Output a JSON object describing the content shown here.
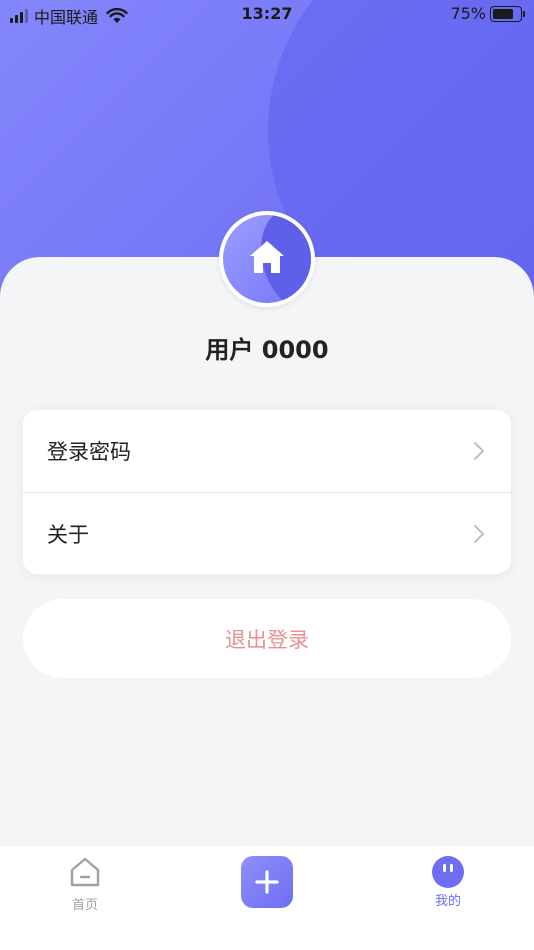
{
  "status_bar": {
    "carrier": "中国联通",
    "time": "13:27",
    "battery": "75%",
    "battery_level": 0.75
  },
  "profile": {
    "avatar_icon": "home-icon",
    "username": "用户 0000"
  },
  "menu": {
    "items": [
      {
        "label": "登录密码",
        "icon": "chevron-right-icon"
      },
      {
        "label": "关于",
        "icon": "chevron-right-icon"
      }
    ]
  },
  "logout": {
    "label": "退出登录",
    "color": "#e9928f"
  },
  "tabbar": {
    "home_label": "首页",
    "add_icon": "plus-icon",
    "mine_label": "我的",
    "active_color": "#6d6ef2",
    "inactive_color": "#a0a0a6"
  },
  "colors": {
    "accent": "#7576f6",
    "background": "#f4f5f7"
  }
}
